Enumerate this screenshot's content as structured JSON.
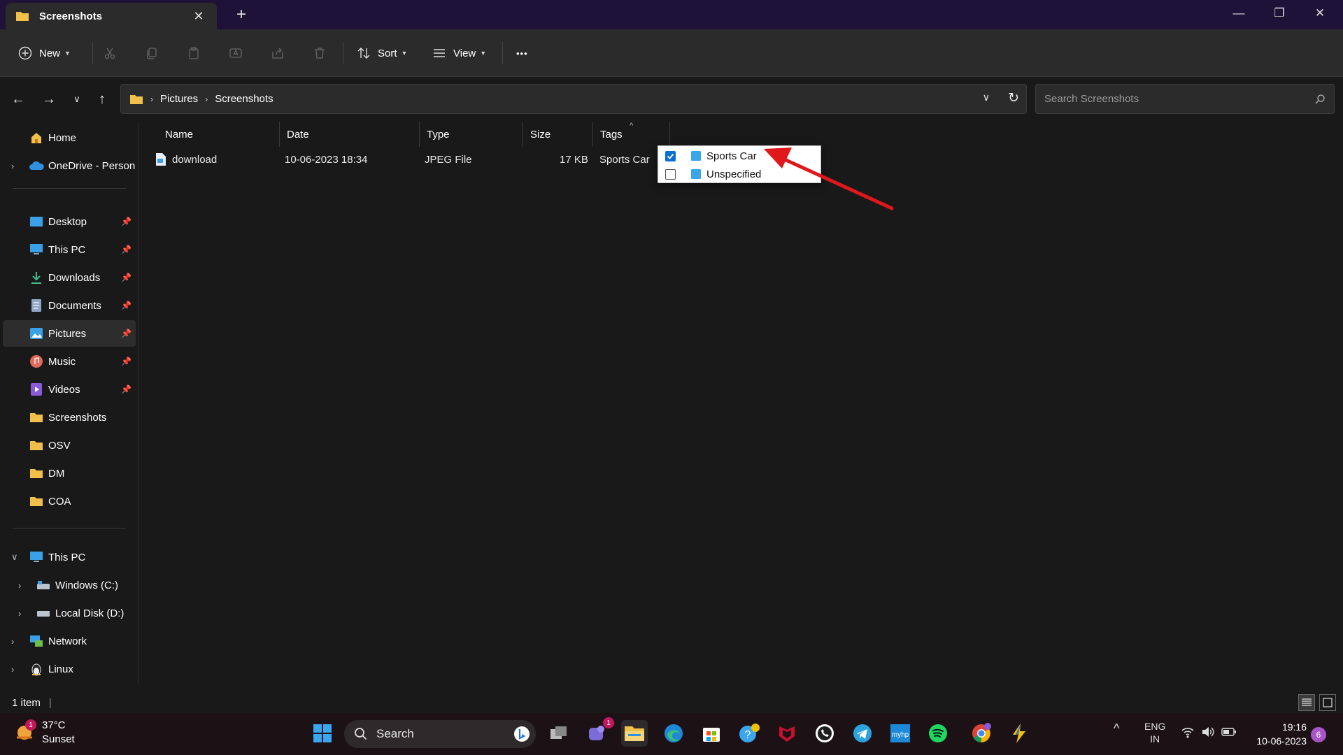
{
  "window": {
    "tab_title": "Screenshots",
    "new_tab": "+",
    "minimize": "—",
    "restore": "❐",
    "close": "✕"
  },
  "toolbar": {
    "new_label": "New",
    "sort_label": "Sort",
    "view_label": "View",
    "more_label": "•••"
  },
  "address": {
    "crumbs": [
      "Pictures",
      "Screenshots"
    ],
    "search_placeholder": "Search Screenshots"
  },
  "sidebar": {
    "quick": [
      {
        "label": "Home",
        "icon": "home-icon"
      },
      {
        "label": "OneDrive - Persona",
        "icon": "onedrive-icon"
      }
    ],
    "pinned": [
      {
        "label": "Desktop",
        "icon": "desktop-icon"
      },
      {
        "label": "This PC",
        "icon": "pc-icon"
      },
      {
        "label": "Downloads",
        "icon": "downloads-icon"
      },
      {
        "label": "Documents",
        "icon": "documents-icon"
      },
      {
        "label": "Pictures",
        "icon": "pictures-icon"
      },
      {
        "label": "Music",
        "icon": "music-icon"
      },
      {
        "label": "Videos",
        "icon": "videos-icon"
      },
      {
        "label": "Screenshots",
        "icon": "folder-icon"
      },
      {
        "label": "OSV",
        "icon": "folder-icon"
      },
      {
        "label": "DM",
        "icon": "folder-icon"
      },
      {
        "label": "COA",
        "icon": "folder-icon"
      }
    ],
    "tree": [
      {
        "label": "This PC",
        "icon": "pc-icon"
      },
      {
        "label": "Windows (C:)",
        "icon": "drive-icon"
      },
      {
        "label": "Local Disk (D:)",
        "icon": "drive-icon"
      },
      {
        "label": "Network",
        "icon": "network-icon"
      },
      {
        "label": "Linux",
        "icon": "linux-icon"
      }
    ],
    "selected": "Pictures"
  },
  "columns": [
    "Name",
    "Date",
    "Type",
    "Size",
    "Tags"
  ],
  "files": [
    {
      "name": "download",
      "date": "10-06-2023 18:34",
      "type": "JPEG File",
      "size": "17 KB",
      "tags": "Sports Car"
    }
  ],
  "tag_popup": {
    "options": [
      {
        "label": "Sports Car",
        "checked": true
      },
      {
        "label": "Unspecified",
        "checked": false
      }
    ]
  },
  "annotation": {
    "arrow_color": "#e0181b"
  },
  "status": {
    "item_count": "1 item"
  },
  "taskbar": {
    "weather_temp": "37°C",
    "weather_desc": "Sunset",
    "weather_badge": "1",
    "search_label": "Search",
    "teams_badge": "1",
    "lang_line1": "ENG",
    "lang_line2": "IN",
    "time": "19:16",
    "date": "10-06-2023",
    "notifications": "6"
  },
  "colors": {
    "accent": "#0a6fd0",
    "folder": "#f0c04a",
    "titlebar": "#1f1238"
  }
}
